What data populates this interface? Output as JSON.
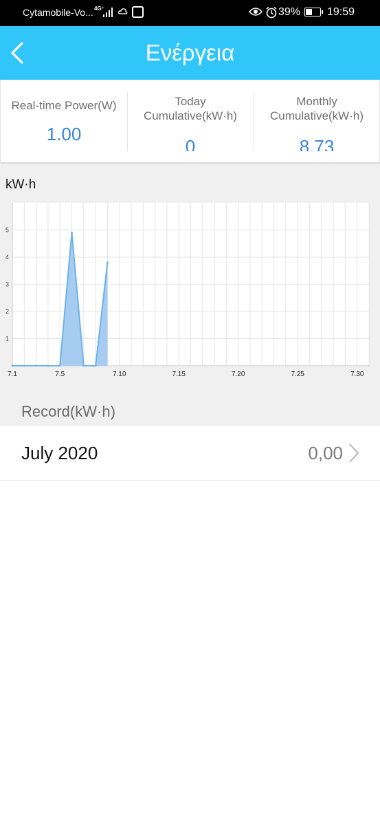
{
  "status_bar": {
    "carrier": "Cytamobile-Vo...",
    "network": "4G⁺",
    "battery_percent": "39%",
    "battery_level": 0.39,
    "time": "19:59"
  },
  "header": {
    "title": "Ενέργεια"
  },
  "stats": {
    "realtime_label": "Real-time Power(W)",
    "realtime_value": "1.00",
    "today_label_line1": "Today",
    "today_label_line2": "Cumulative(kW·h)",
    "today_value": "0",
    "monthly_label_line1": "Monthly",
    "monthly_label_line2": "Cumulative(kW·h)",
    "monthly_value": "8.73"
  },
  "chart_unit": "kW·h",
  "chart_data": {
    "type": "area",
    "title": "",
    "xlabel": "",
    "ylabel": "kW·h",
    "x_ticks": [
      "7.1",
      "7.5",
      "7.10",
      "7.15",
      "7.20",
      "7.25",
      "7.30"
    ],
    "x_tick_days": [
      1,
      5,
      10,
      15,
      20,
      25,
      30
    ],
    "y_ticks": [
      "1",
      "2",
      "3",
      "4",
      "5"
    ],
    "y_tick_values": [
      1,
      2,
      3,
      4,
      5
    ],
    "xlim": [
      1,
      31
    ],
    "ylim": [
      0,
      6
    ],
    "grid": true,
    "fill_color": "#a6ccf2",
    "line_color": "#6cb3ea",
    "x": [
      1,
      2,
      3,
      4,
      5,
      6,
      7,
      8,
      9
    ],
    "values": [
      0,
      0,
      0,
      0,
      0,
      4.9,
      0,
      0,
      3.8
    ]
  },
  "record_section": {
    "label": "Record(kW·h)",
    "rows": [
      {
        "month": "July 2020",
        "value": "0,00"
      }
    ]
  }
}
